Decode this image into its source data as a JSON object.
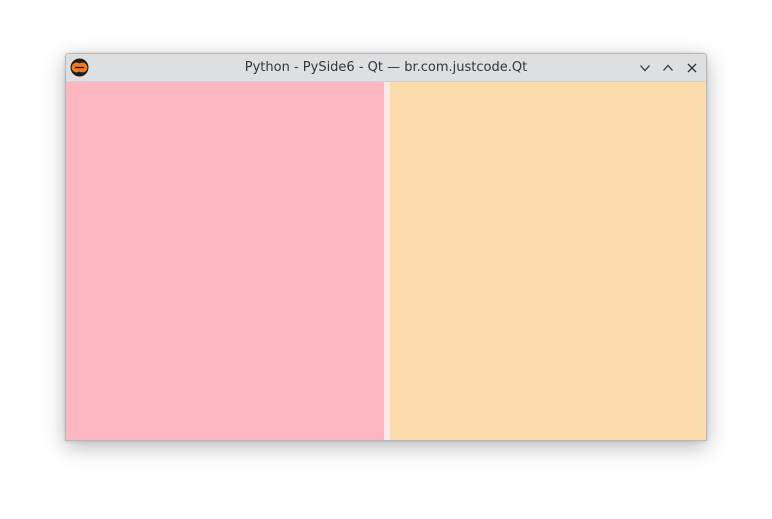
{
  "window": {
    "title": "Python - PySide6 - Qt — br.com.justcode.Qt",
    "icon": "python-app-icon",
    "controls": {
      "minimize": "chevron-down-icon",
      "maximize": "chevron-up-icon",
      "close": "close-icon"
    }
  },
  "panes": {
    "left": {
      "color": "#feb6c1"
    },
    "right": {
      "color": "#fcdbac"
    }
  }
}
